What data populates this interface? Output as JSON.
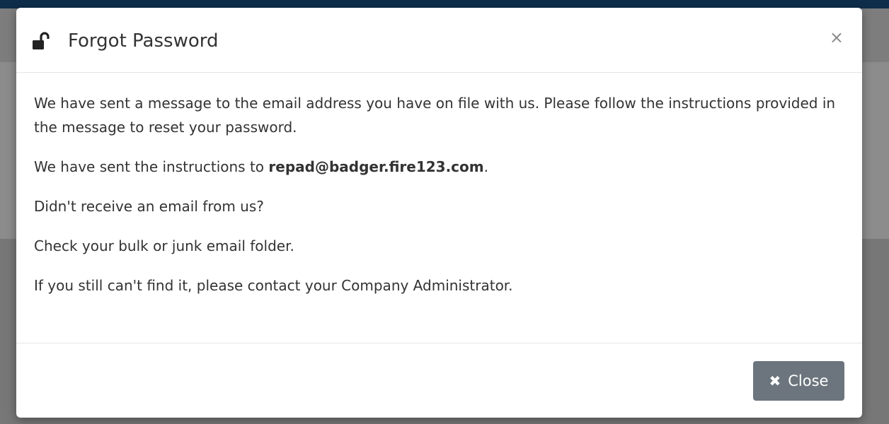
{
  "modal": {
    "title": "Forgot Password",
    "title_icon": "lock-open-icon",
    "dismiss_symbol": "×",
    "body": {
      "paragraph1": "We have sent a message to the email address you have on file with us. Please follow the instructions provided in the message to reset your password.",
      "paragraph2_prefix": "We have sent the instructions to ",
      "email": "repad@badger.fire123.com",
      "paragraph2_suffix": ".",
      "paragraph3": "Didn't receive an email from us?",
      "paragraph4": "Check your bulk or junk email folder.",
      "paragraph5": "If you still can't find it, please contact your Company Administrator."
    },
    "footer": {
      "close_label": "Close",
      "close_icon_glyph": "✖",
      "close_icon": "times-icon"
    }
  },
  "colors": {
    "navbar": "#0e2d4a",
    "button": "#6c757d",
    "text": "#333333"
  }
}
